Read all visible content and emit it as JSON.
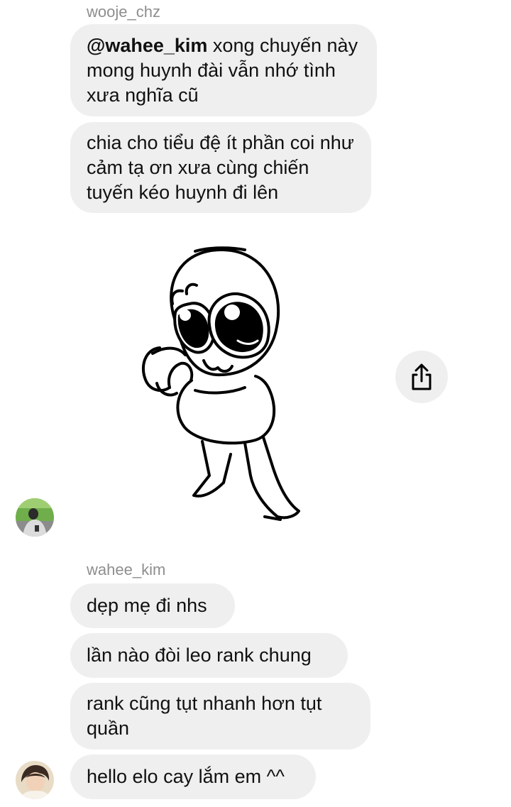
{
  "thread": {
    "group1": {
      "sender": "wooje_chz",
      "messages": [
        {
          "mention": "@wahee_kim",
          "text": " xong chuyến này mong huynh đài vẫn nhớ tình xưa nghĩa cũ"
        },
        {
          "text": "chia cho tiểu đệ ít phần coi như cảm tạ ơn xưa cùng chiến tuyến kéo huynh đi lên"
        }
      ],
      "sticker_icon": "cartoon-character-sticker",
      "share_icon": "share-icon"
    },
    "group2": {
      "sender": "wahee_kim",
      "messages": [
        {
          "text": "dẹp mẹ đi nhs"
        },
        {
          "text": "lần nào đòi leo rank chung"
        },
        {
          "text": "rank cũng tụt nhanh hơn tụt quần"
        },
        {
          "text": "hello elo cay lắm em ^^"
        }
      ]
    }
  },
  "colors": {
    "bubble_bg": "#efefef",
    "sender_text": "#8e8e8e",
    "message_text": "#111111"
  }
}
